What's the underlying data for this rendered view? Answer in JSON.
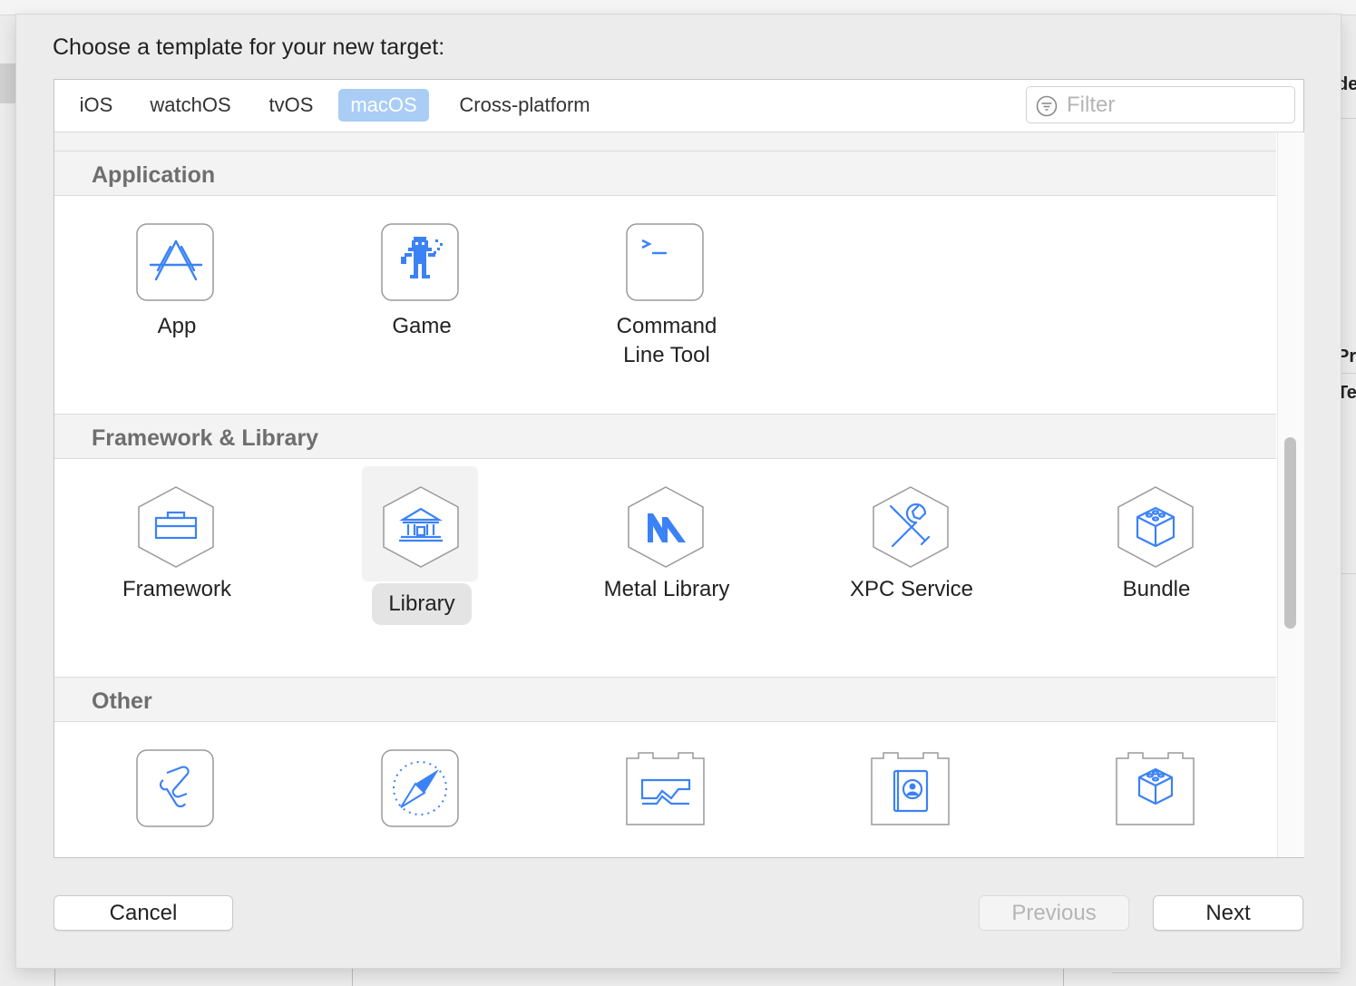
{
  "background": {
    "right_fragments": [
      "de",
      "Pro",
      "Tex"
    ]
  },
  "sheet": {
    "title": "Choose a template for your new target:",
    "tabs": [
      {
        "label": "iOS",
        "selected": false
      },
      {
        "label": "watchOS",
        "selected": false
      },
      {
        "label": "tvOS",
        "selected": false
      },
      {
        "label": "macOS",
        "selected": true
      },
      {
        "label": "Cross-platform",
        "selected": false
      }
    ],
    "filter": {
      "placeholder": "Filter",
      "value": ""
    },
    "sections": [
      {
        "title": "Application",
        "items": [
          {
            "label": "App",
            "icon": "app-store-icon"
          },
          {
            "label": "Game",
            "icon": "game-icon"
          },
          {
            "label": "Command\nLine Tool",
            "icon": "terminal-icon"
          }
        ]
      },
      {
        "title": "Framework & Library",
        "items": [
          {
            "label": "Framework",
            "icon": "toolbox-icon"
          },
          {
            "label": "Library",
            "icon": "library-building-icon",
            "selected": true
          },
          {
            "label": "Metal Library",
            "icon": "metal-icon"
          },
          {
            "label": "XPC Service",
            "icon": "wrench-screwdriver-icon"
          },
          {
            "label": "Bundle",
            "icon": "bundle-cube-icon"
          }
        ]
      },
      {
        "title": "Other",
        "items": [
          {
            "label": "",
            "icon": "scroll-icon"
          },
          {
            "label": "",
            "icon": "safari-compass-icon"
          },
          {
            "label": "",
            "icon": "plugin-icon"
          },
          {
            "label": "",
            "icon": "contacts-plugin-icon"
          },
          {
            "label": "",
            "icon": "cube-plugin-icon"
          }
        ]
      }
    ],
    "buttons": {
      "cancel": "Cancel",
      "previous": "Previous",
      "next": "Next"
    }
  },
  "colors": {
    "accent": "#3b82f6",
    "tab_selected": "#a9cdf5",
    "section_header_text": "#6e6e6e"
  }
}
